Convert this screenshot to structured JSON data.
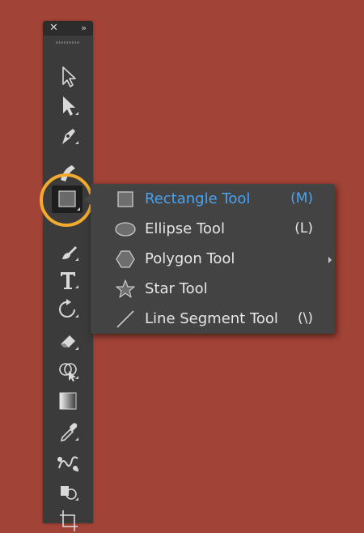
{
  "toolbar": {
    "close_glyph": "✕",
    "collapse_glyph": "»",
    "tools": [
      {
        "name": "selection-tool",
        "icon": "selection-arrow-icon"
      },
      {
        "name": "direct-selection-tool",
        "icon": "direct-selection-arrow-icon"
      },
      {
        "name": "pen-tool",
        "icon": "pen-icon"
      },
      {
        "name": "curvature-tool",
        "icon": "curvature-pen-icon"
      },
      {
        "name": "rectangle-tool",
        "icon": "rectangle-icon",
        "selected": true
      },
      {
        "name": "paintbrush-tool",
        "icon": "paintbrush-icon"
      },
      {
        "name": "type-tool",
        "icon": "type-icon"
      },
      {
        "name": "rotate-tool",
        "icon": "rotate-icon"
      },
      {
        "name": "eraser-tool",
        "icon": "eraser-icon"
      },
      {
        "name": "shape-builder-tool",
        "icon": "shape-builder-icon"
      },
      {
        "name": "gradient-tool",
        "icon": "gradient-icon"
      },
      {
        "name": "eyedropper-tool",
        "icon": "eyedropper-icon"
      },
      {
        "name": "blend-tool",
        "icon": "blend-icon"
      },
      {
        "name": "symbol-sprayer-tool",
        "icon": "symbol-sprayer-icon"
      },
      {
        "name": "artboard-tool",
        "icon": "artboard-icon"
      }
    ]
  },
  "flyout": {
    "items": [
      {
        "label": "Rectangle Tool",
        "shortcut": "(M)",
        "icon": "rectangle-icon",
        "active": true
      },
      {
        "label": "Ellipse Tool",
        "shortcut": "(L)",
        "icon": "ellipse-icon"
      },
      {
        "label": "Polygon Tool",
        "shortcut": "",
        "icon": "polygon-icon"
      },
      {
        "label": "Star Tool",
        "shortcut": "",
        "icon": "star-icon"
      },
      {
        "label": "Line Segment Tool",
        "shortcut": "(\\)",
        "icon": "line-icon"
      }
    ]
  },
  "colors": {
    "background": "#a14336",
    "panel": "#3b3b3b",
    "highlight_ring": "#f2ab2e",
    "active_text": "#4aa3f0"
  }
}
